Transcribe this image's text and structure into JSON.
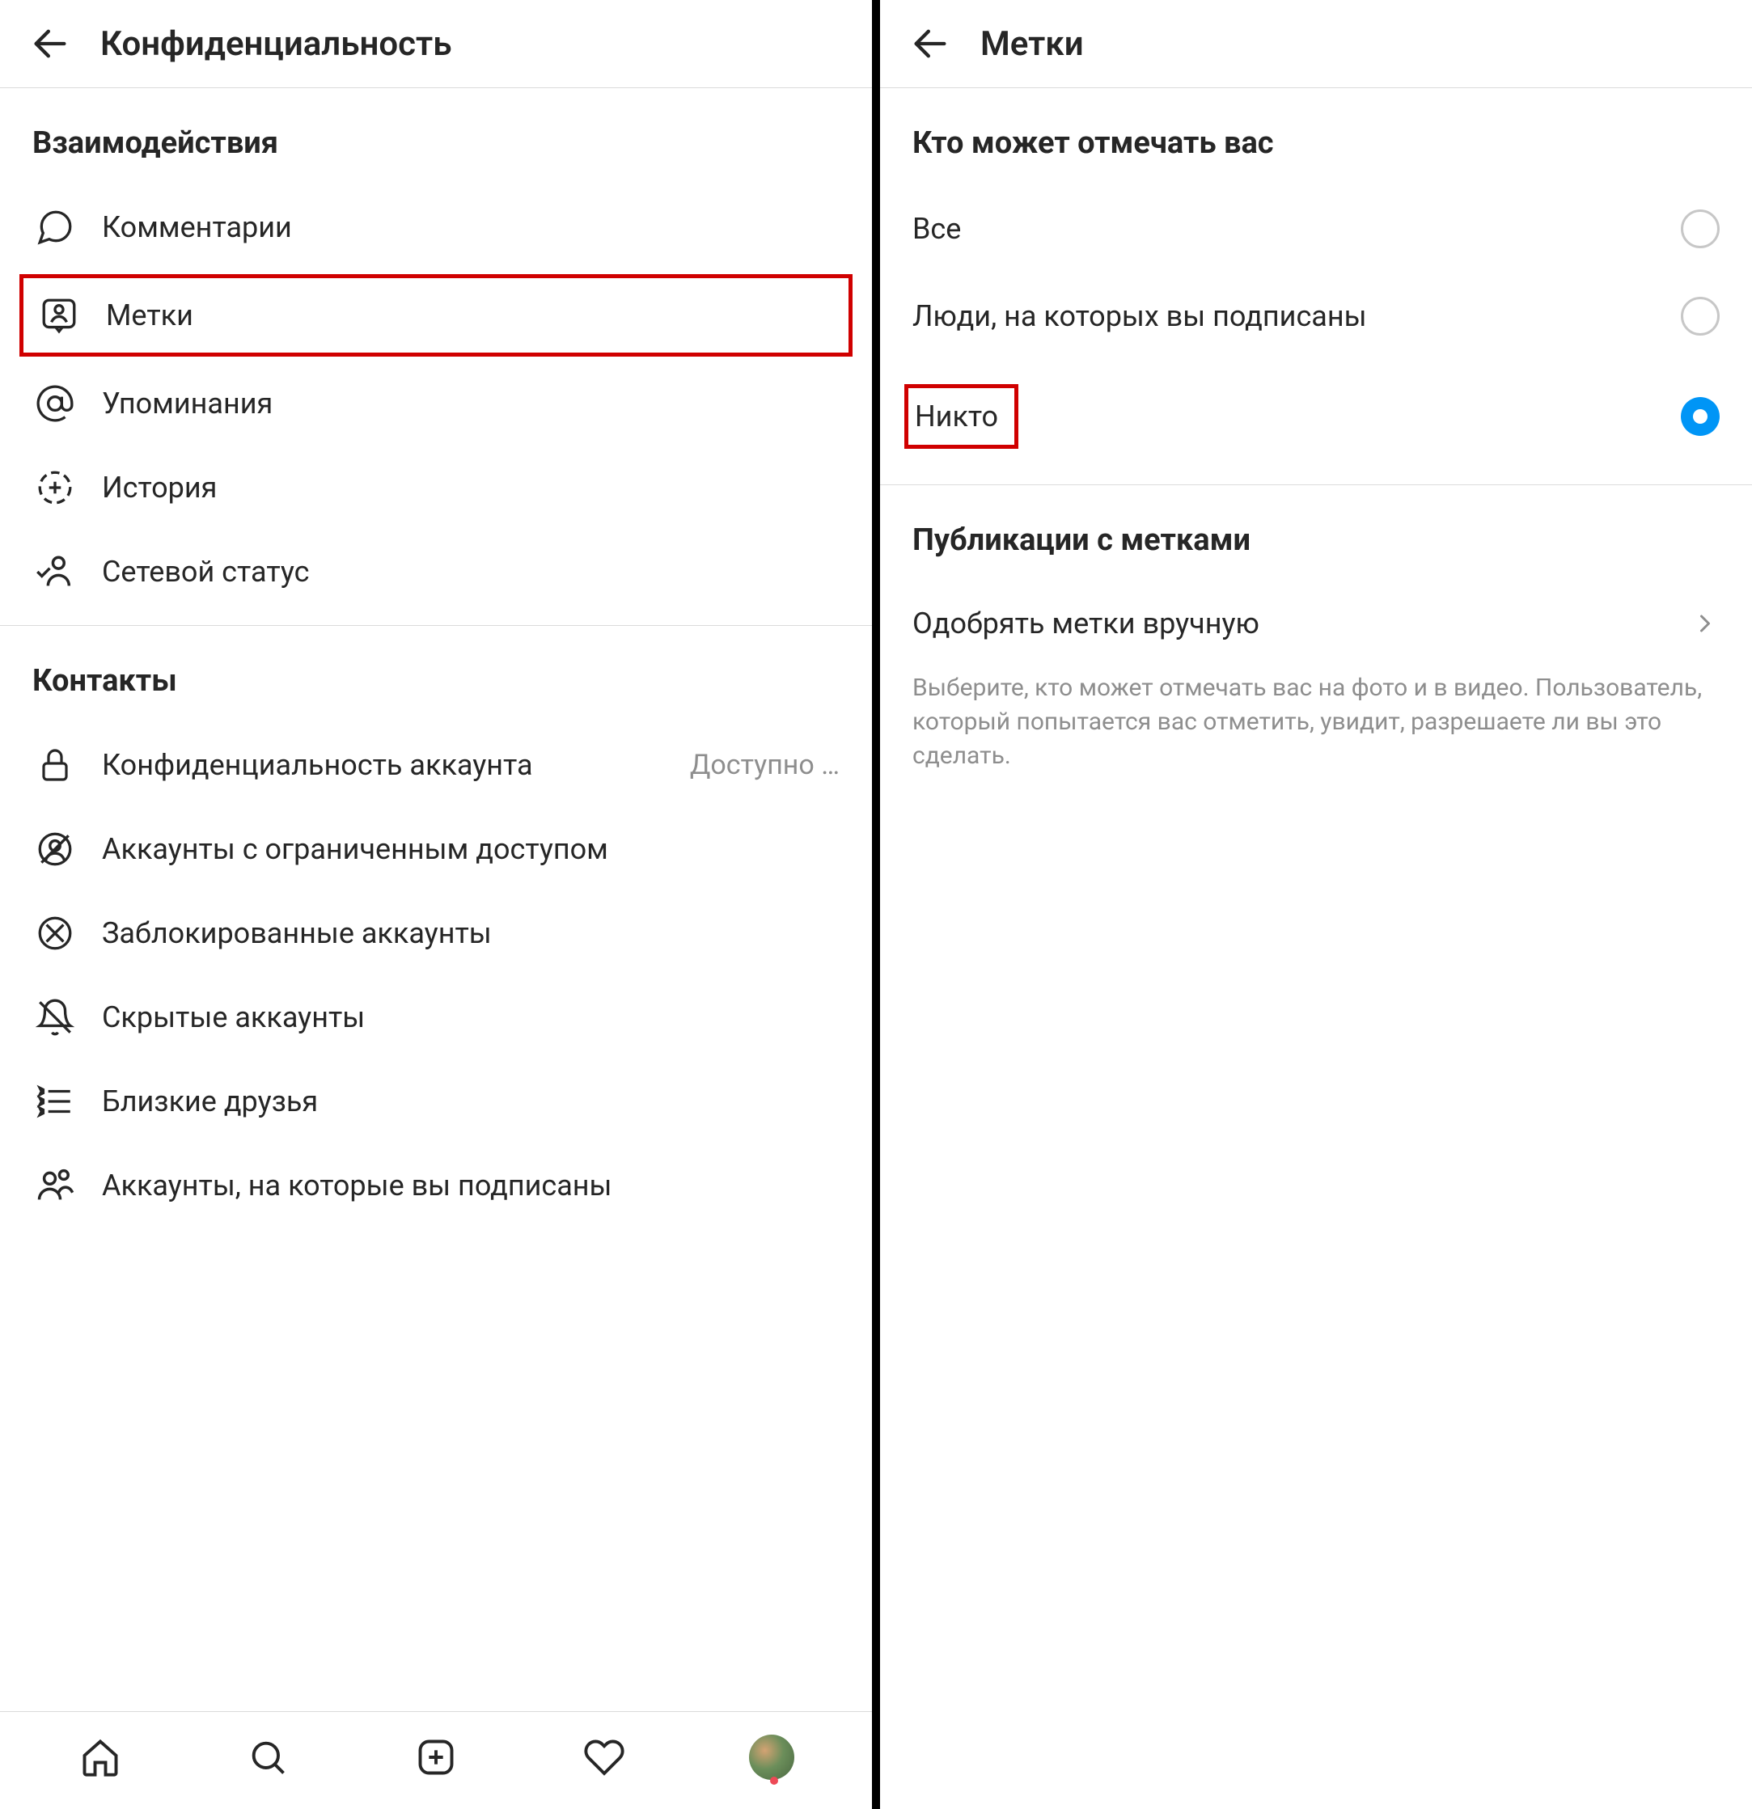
{
  "left": {
    "header_title": "Конфиденциальность",
    "section_interactions": "Взаимодействия",
    "items_interactions": [
      {
        "label": "Комментарии"
      },
      {
        "label": "Метки"
      },
      {
        "label": "Упоминания"
      },
      {
        "label": "История"
      },
      {
        "label": "Сетевой статус"
      }
    ],
    "section_contacts": "Контакты",
    "items_contacts": [
      {
        "label": "Конфиденциальность аккаунта",
        "secondary": "Доступно …"
      },
      {
        "label": "Аккаунты с ограниченным доступом"
      },
      {
        "label": "Заблокированные аккаунты"
      },
      {
        "label": "Скрытые аккаунты"
      },
      {
        "label": "Близкие друзья"
      },
      {
        "label": "Аккаунты, на которые вы подписаны"
      }
    ]
  },
  "right": {
    "header_title": "Метки",
    "section_who": "Кто может отмечать вас",
    "radios": [
      {
        "label": "Все",
        "selected": false
      },
      {
        "label": "Люди, на которых вы подписаны",
        "selected": false
      },
      {
        "label": "Никто",
        "selected": true
      }
    ],
    "section_posts": "Публикации с метками",
    "approve_label": "Одобрять метки вручную",
    "help_text": "Выберите, кто может отмечать вас на фото и в видео. Пользователь, который попытается вас отметить, увидит, разрешаете ли вы это сделать."
  }
}
